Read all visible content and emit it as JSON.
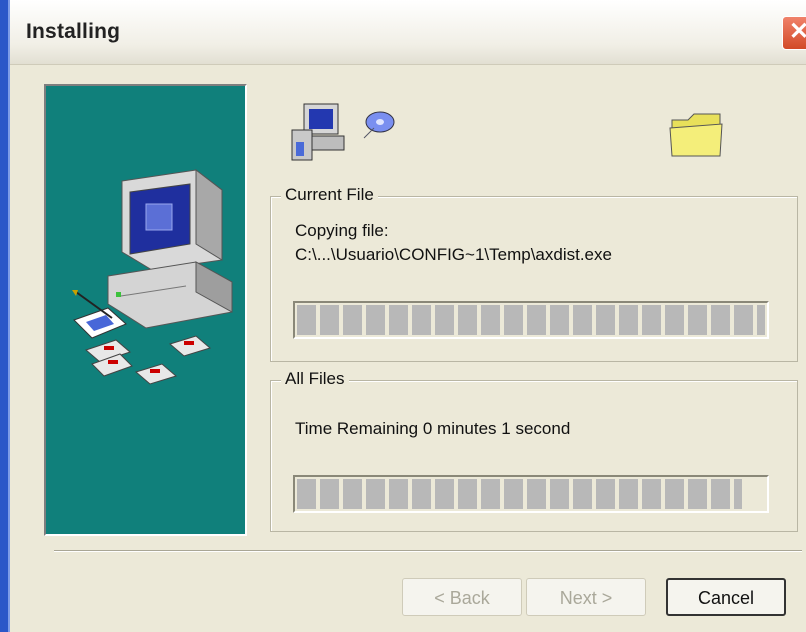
{
  "window": {
    "title": "Installing",
    "close_glyph": "✕"
  },
  "icons": {
    "banner": "computer-install-illustration",
    "source": "computer-icon",
    "transfer": "flying-disk-icon",
    "destination": "folder-icon"
  },
  "current_file": {
    "label": "Current File",
    "action": "Copying file:",
    "path": "C:\\...\\Usuario\\CONFIG~1\\Temp\\axdist.exe",
    "progress_fraction": 1.0
  },
  "all_files": {
    "label": "All Files",
    "time_remaining": "Time Remaining 0 minutes 1 second",
    "progress_fraction": 0.95
  },
  "buttons": {
    "back": "< Back",
    "next": "Next >",
    "cancel": "Cancel"
  },
  "colors": {
    "banner_bg": "#10807b",
    "progress_block": "#b8b8b8",
    "dialog_bg": "#ece9d8"
  }
}
